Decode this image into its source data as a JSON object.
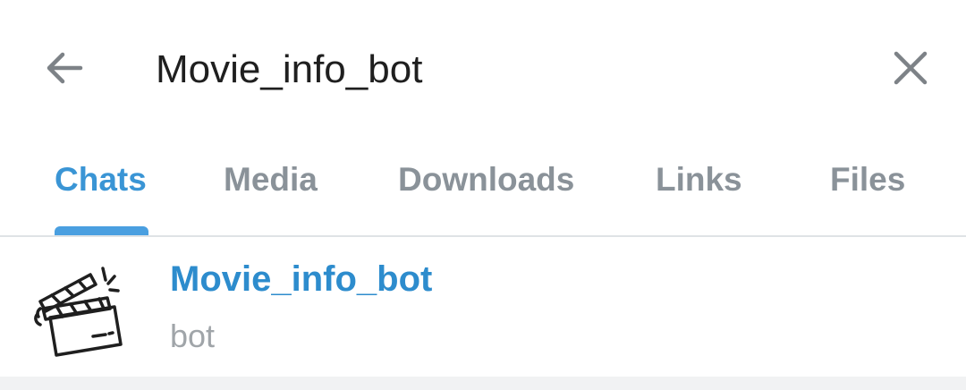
{
  "search": {
    "query": "Movie_info_bot",
    "back_icon": "arrow-left-icon",
    "clear_icon": "close-icon"
  },
  "tabs": [
    {
      "label": "Chats",
      "active": true
    },
    {
      "label": "Media",
      "active": false
    },
    {
      "label": "Downloads",
      "active": false
    },
    {
      "label": "Links",
      "active": false
    },
    {
      "label": "Files",
      "active": false
    }
  ],
  "results": [
    {
      "name": "Movie_info_bot",
      "subtitle": "bot",
      "avatar_icon": "clapperboard-icon"
    }
  ],
  "colors": {
    "accent": "#3a95d5",
    "name_blue": "#2d8ccd",
    "inactive_tab": "#8a9299",
    "subtitle_gray": "#a0a5a9",
    "icon_gray": "#7d8287"
  }
}
